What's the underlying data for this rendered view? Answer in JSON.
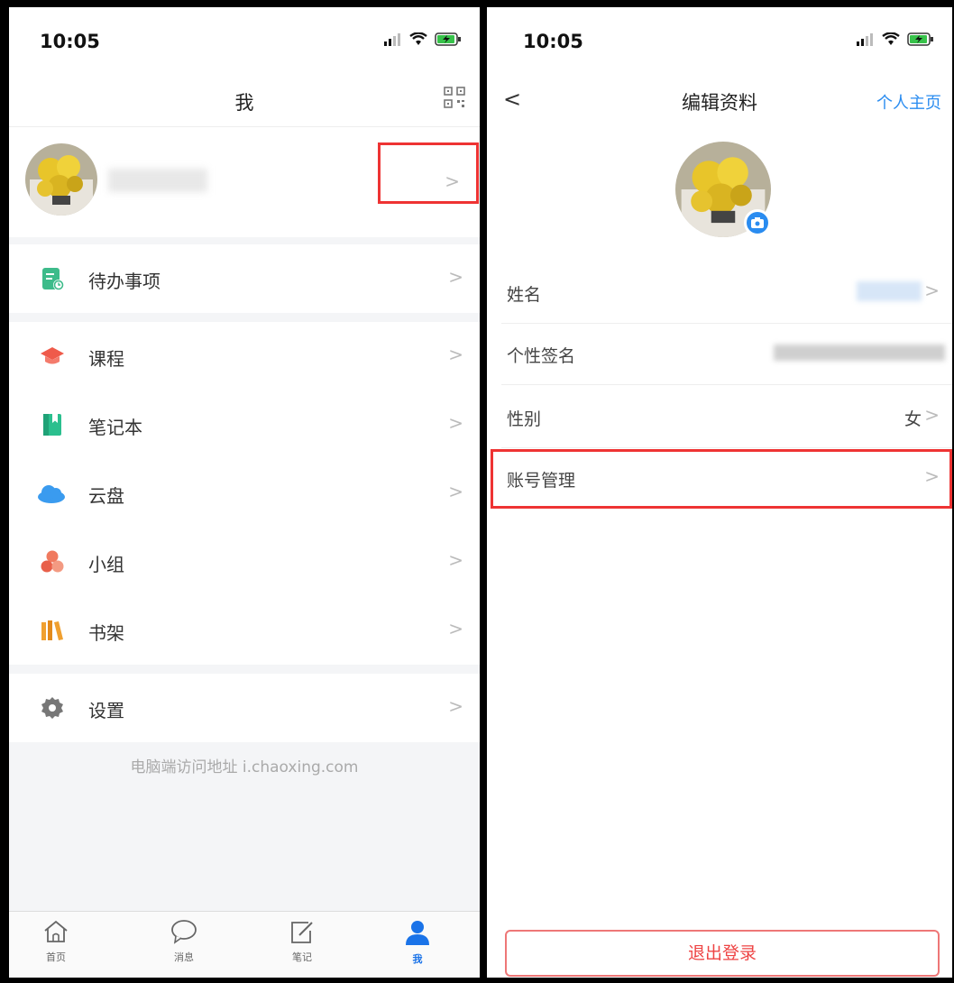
{
  "left_screen": {
    "status": {
      "time": "10:05"
    },
    "header": {
      "title": "我",
      "qr_icon": "qr-code-icon"
    },
    "menu": [
      {
        "label": "待办事项",
        "icon": "todo-icon",
        "color": "#3dbb8a"
      },
      {
        "label": "课程",
        "icon": "graduation-cap-icon",
        "color": "#ef5a4a"
      },
      {
        "label": "笔记本",
        "icon": "notebook-icon",
        "color": "#2bbf8e"
      },
      {
        "label": "云盘",
        "icon": "cloud-icon",
        "color": "#3a9bef"
      },
      {
        "label": "小组",
        "icon": "group-icon",
        "color": "#f07a5f"
      },
      {
        "label": "书架",
        "icon": "bookshelf-icon",
        "color": "#f0a030"
      },
      {
        "label": "设置",
        "icon": "gear-icon",
        "color": "#777777"
      }
    ],
    "footer_note": "电脑端访问地址 i.chaoxing.com",
    "tabs": [
      {
        "label": "首页",
        "icon": "home-icon"
      },
      {
        "label": "消息",
        "icon": "message-icon"
      },
      {
        "label": "笔记",
        "icon": "note-edit-icon"
      },
      {
        "label": "我",
        "icon": "user-icon",
        "active": true
      }
    ]
  },
  "right_screen": {
    "status": {
      "time": "10:05"
    },
    "header": {
      "title": "编辑资料",
      "link": "个人主页"
    },
    "fields": [
      {
        "label": "姓名"
      },
      {
        "label": "个性签名"
      },
      {
        "label": "性别",
        "value": "女"
      },
      {
        "label": "账号管理"
      }
    ],
    "logout": "退出登录"
  },
  "colors": {
    "accent": "#2a8cf0",
    "highlight": "#e33333",
    "bg_gray": "#f4f5f7"
  }
}
